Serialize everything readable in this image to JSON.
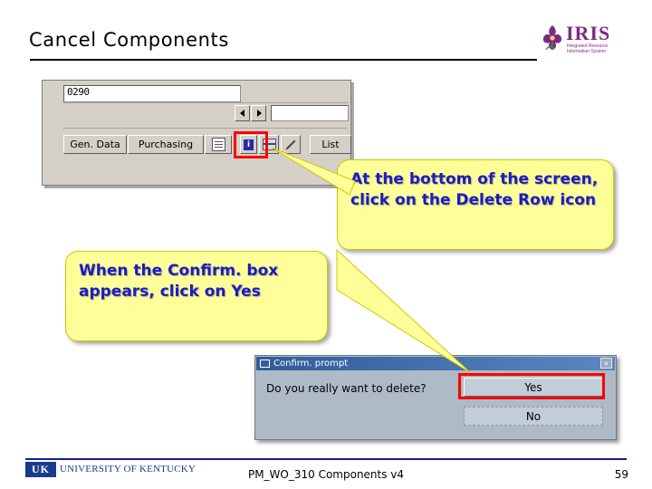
{
  "slide": {
    "title": "Cancel Components",
    "page_number": "59",
    "footer_text": "PM_WO_310 Components v4"
  },
  "logo": {
    "iris_text": "IRIS",
    "iris_tagline": "Integrated Resource Information System",
    "uk_mark": "UK",
    "uk_name": "UNIVERSITY OF KENTUCKY"
  },
  "sap_screenshot": {
    "field_value": "0290",
    "tabs": [
      {
        "label": "Gen. Data"
      },
      {
        "label": "Purchasing"
      }
    ],
    "buttons": {
      "info": "i",
      "list": "List"
    }
  },
  "callouts": [
    {
      "id": "delete-row",
      "text": "At the bottom of the screen, click on the Delete Row icon"
    },
    {
      "id": "confirm-box",
      "text": "When the Confirm. box appears, click on Yes"
    }
  ],
  "confirm_dialog": {
    "title": "Confirm. prompt",
    "message": "Do you really want to delete?",
    "yes_label": "Yes",
    "no_label": "No",
    "close_label": "×"
  },
  "colors": {
    "callout_fill": "#ffff99",
    "callout_text": "#1c1cc0",
    "highlight": "#ff0000",
    "iris_purple": "#7b2b86",
    "uk_blue": "#1b3a8f"
  }
}
